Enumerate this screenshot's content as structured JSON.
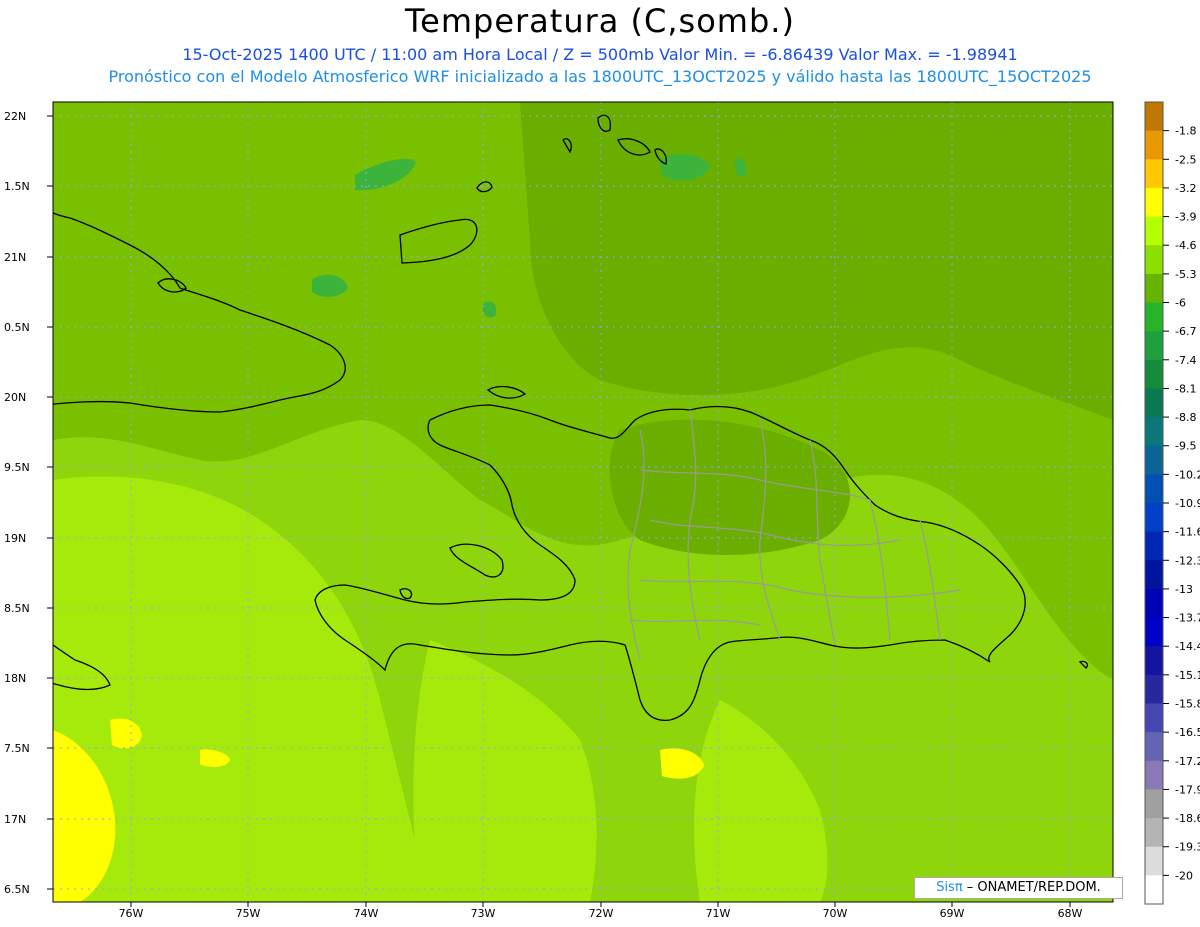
{
  "header": {
    "title": "Temperatura (C,somb.)",
    "line1": "15-Oct-2025  1400 UTC / 11:00 am Hora Local / Z = 500mb  Valor Min. = -6.86439  Valor Max. = -1.98941",
    "line2": "Pronóstico con el Modelo Atmosferico WRF inicializado a las 1800UTC_13OCT2025 y válido hasta las  1800UTC_15OCT2025"
  },
  "axes": {
    "lat_labels": [
      "22N",
      "1.5N",
      "21N",
      "0.5N",
      "20N",
      "9.5N",
      "19N",
      "8.5N",
      "18N",
      "7.5N",
      "17N",
      "6.5N"
    ],
    "lon_labels": [
      "76W",
      "75W",
      "74W",
      "73W",
      "72W",
      "71W",
      "70W",
      "69W",
      "68W"
    ]
  },
  "colorbar": {
    "labels": [
      "-1.8",
      "-2.5",
      "-3.2",
      "-3.9",
      "-4.6",
      "-5.3",
      "-6",
      "-6.7",
      "-7.4",
      "-8.1",
      "-8.8",
      "-9.5",
      "-10.2",
      "-10.9",
      "-11.6",
      "-12.3",
      "-13",
      "-13.7",
      "-14.4",
      "-15.1",
      "-15.8",
      "-16.5",
      "-17.2",
      "-17.9",
      "-18.6",
      "-19.3",
      "-20"
    ],
    "colors": [
      "#c07800",
      "#e89800",
      "#ffc800",
      "#ffff00",
      "#b4ff00",
      "#8ce000",
      "#64b400",
      "#28b428",
      "#1ea03c",
      "#148c3c",
      "#0a7850",
      "#0a7878",
      "#0a6496",
      "#0050b4",
      "#0040c8",
      "#0028b4",
      "#0014a0",
      "#0000b4",
      "#0000c8",
      "#1414a0",
      "#28289e",
      "#4646b4",
      "#6464b4",
      "#8c78b4",
      "#a0a0a0",
      "#b4b4b4",
      "#dcdcdc",
      "#ffffff"
    ]
  },
  "credit": {
    "sis": "Sisπ",
    "rest": " – ONAMET/REP.DOM."
  },
  "field_colors": {
    "base": "#8ed60b",
    "darker": "#78c000",
    "darkest": "#6aae00",
    "lighter": "#a6ea0c",
    "yellow": "#ffff00",
    "green": "#3cb43c"
  }
}
